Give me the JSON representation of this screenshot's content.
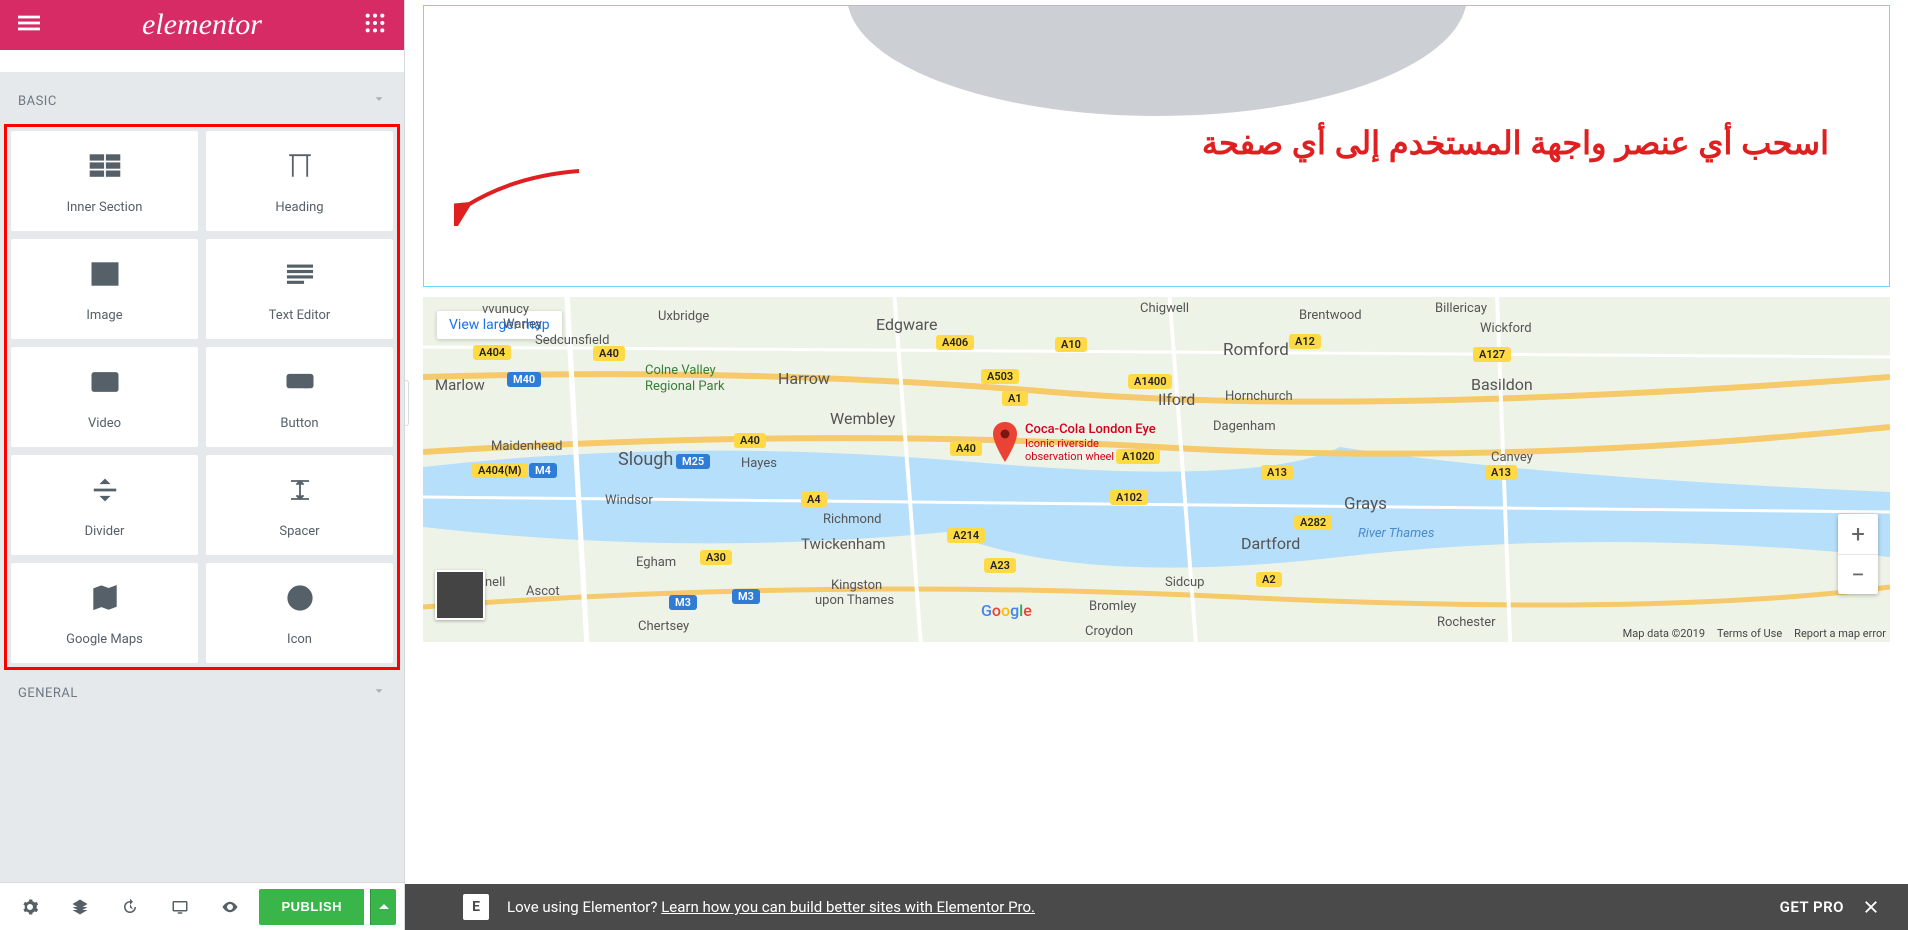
{
  "header": {
    "logo": "elementor"
  },
  "categories": {
    "basic": "BASIC",
    "general": "GENERAL"
  },
  "widgets": [
    {
      "label": "Inner Section",
      "icon": "inner-section-icon"
    },
    {
      "label": "Heading",
      "icon": "heading-icon"
    },
    {
      "label": "Image",
      "icon": "image-icon"
    },
    {
      "label": "Text Editor",
      "icon": "text-editor-icon"
    },
    {
      "label": "Video",
      "icon": "video-icon"
    },
    {
      "label": "Button",
      "icon": "button-icon"
    },
    {
      "label": "Divider",
      "icon": "divider-icon"
    },
    {
      "label": "Spacer",
      "icon": "spacer-icon"
    },
    {
      "label": "Google Maps",
      "icon": "google-maps-icon"
    },
    {
      "label": "Icon",
      "icon": "star-icon"
    }
  ],
  "footer": {
    "publish": "PUBLISH"
  },
  "tip": {
    "text": "اسحب أي عنصر واجهة المستخدم إلى أي صفحة"
  },
  "map": {
    "view_larger": "View larger map",
    "pin_title": "Coca-Cola London Eye",
    "pin_sub1": "Iconic riverside",
    "pin_sub2": "observation wheel",
    "attr_data": "Map data ©2019",
    "attr_terms": "Terms of Use",
    "attr_report": "Report a map error",
    "labels": {
      "uxbridge": "Uxbridge",
      "vvunucy": "vvunucy",
      "warley": "Warley",
      "sedcunsfield": "Sedcunsfield",
      "marlow": "Marlow",
      "colne_valley": "Colne Valley",
      "regional_park": "Regional Park",
      "maidenhead": "Maidenhead",
      "slough": "Slough",
      "hayes": "Hayes",
      "windsor": "Windsor",
      "harrow": "Harrow",
      "wembley": "Wembley",
      "edgware": "Edgware",
      "richmond": "Richmond",
      "twickenham": "Twickenham",
      "kingston": "Kingston",
      "upon_thames": "upon Thames",
      "egham": "Egham",
      "ascot": "Ascot",
      "chertsey": "Chertsey",
      "croydon": "Croydon",
      "ilford": "Ilford",
      "romford": "Romford",
      "hornchurch": "Hornchurch",
      "dagenham": "Dagenham",
      "sidcup": "Sidcup",
      "bromley": "Bromley",
      "dartford": "Dartford",
      "grays": "Grays",
      "basildon": "Basildon",
      "canvey": "Canvey",
      "rochester": "Rochester",
      "brentwood": "Brentwood",
      "billericay": "Billericay",
      "wickford": "Wickford",
      "chigwell": "Chigwell",
      "nell": "nell",
      "river_thames": "River Thames"
    },
    "roads": {
      "a404": "A404",
      "a40": "A40",
      "m40": "M40",
      "a404m": "A404(M)",
      "m4": "M4",
      "m25": "M25",
      "a1": "A1",
      "a10": "A10",
      "a503": "A503",
      "a406": "A406",
      "a4": "A4",
      "a214": "A214",
      "a30": "A30",
      "a23": "A23",
      "m3": "M3",
      "a12": "A12",
      "a127": "A127",
      "a13_1": "A13",
      "a13_2": "A13",
      "a40_2": "A40",
      "a13_3": "A13",
      "a102": "A102",
      "a282": "A282",
      "a2": "A2",
      "a1020": "A1020",
      "a1400": "A1400"
    }
  },
  "promo": {
    "text": "Love using Elementor? ",
    "link": "Learn how you can build better sites with Elementor Pro.",
    "cta": "GET PRO"
  }
}
